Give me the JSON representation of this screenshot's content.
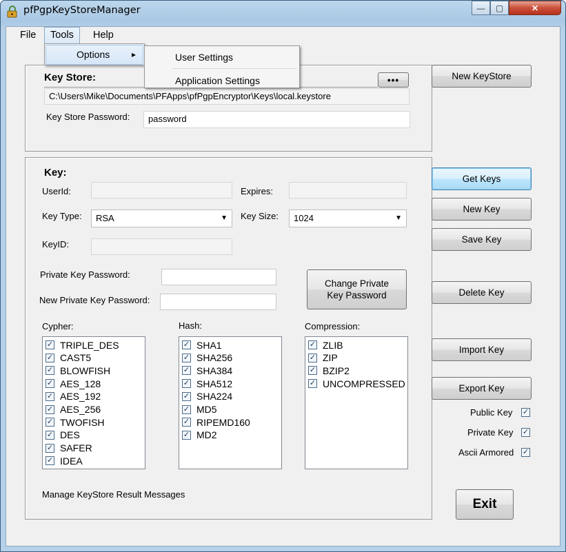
{
  "window": {
    "title": "pfPgpKeyStoreManager",
    "minimize": "—",
    "maximize": "▢",
    "close": "✕"
  },
  "menu": {
    "file": "File",
    "tools": "Tools",
    "help": "Help"
  },
  "tools_menu": {
    "options": "Options",
    "submenu_arrow": "▸"
  },
  "options_submenu": [
    "User Settings",
    "Application Settings"
  ],
  "keystore": {
    "heading": "Key Store:",
    "path": "C:\\Users\\Mike\\Documents\\PFApps\\pfPgpEncryptor\\Keys\\local.keystore",
    "browse_label": "•••",
    "password_label": "Key Store Password:",
    "password_value": "password"
  },
  "key": {
    "heading": "Key:",
    "userid_label": "UserId:",
    "userid_value": "",
    "expires_label": "Expires:",
    "expires_value": "",
    "keytype_label": "Key Type:",
    "keytype_value": "RSA",
    "keysize_label": "Key Size:",
    "keysize_value": "1024",
    "keyid_label": "KeyID:",
    "keyid_value": "",
    "private_pw_label": "Private Key Password:",
    "new_private_pw_label": "New Private Key Password:",
    "change_pw_button": "Change Private Key Password",
    "cypher_label": "Cypher:",
    "hash_label": "Hash:",
    "compression_label": "Compression:",
    "result_messages": "Manage KeyStore Result Messages"
  },
  "cyphers": [
    {
      "name": "TRIPLE_DES",
      "checked": true
    },
    {
      "name": "CAST5",
      "checked": true
    },
    {
      "name": "BLOWFISH",
      "checked": true
    },
    {
      "name": "AES_128",
      "checked": true
    },
    {
      "name": "AES_192",
      "checked": true
    },
    {
      "name": "AES_256",
      "checked": true
    },
    {
      "name": "TWOFISH",
      "checked": true
    },
    {
      "name": "DES",
      "checked": true
    },
    {
      "name": "SAFER",
      "checked": true
    },
    {
      "name": "IDEA",
      "checked": true
    }
  ],
  "hashes": [
    {
      "name": "SHA1",
      "checked": true
    },
    {
      "name": "SHA256",
      "checked": true
    },
    {
      "name": "SHA384",
      "checked": true
    },
    {
      "name": "SHA512",
      "checked": true
    },
    {
      "name": "SHA224",
      "checked": true
    },
    {
      "name": "MD5",
      "checked": true
    },
    {
      "name": "RIPEMD160",
      "checked": true
    },
    {
      "name": "MD2",
      "checked": true
    }
  ],
  "compressions": [
    {
      "name": "ZLIB",
      "checked": true
    },
    {
      "name": "ZIP",
      "checked": true
    },
    {
      "name": "BZIP2",
      "checked": true
    },
    {
      "name": "UNCOMPRESSED",
      "checked": true
    }
  ],
  "buttons": {
    "new_keystore": "New KeyStore",
    "get_keys": "Get Keys",
    "new_key": "New Key",
    "save_key": "Save Key",
    "delete_key": "Delete Key",
    "import_key": "Import Key",
    "export_key": "Export Key",
    "exit": "Exit"
  },
  "export_options": {
    "public_key": "Public Key",
    "public_key_checked": true,
    "private_key": "Private Key",
    "private_key_checked": true,
    "ascii_armored": "Ascii Armored",
    "ascii_armored_checked": true
  },
  "check_glyph": "✓"
}
